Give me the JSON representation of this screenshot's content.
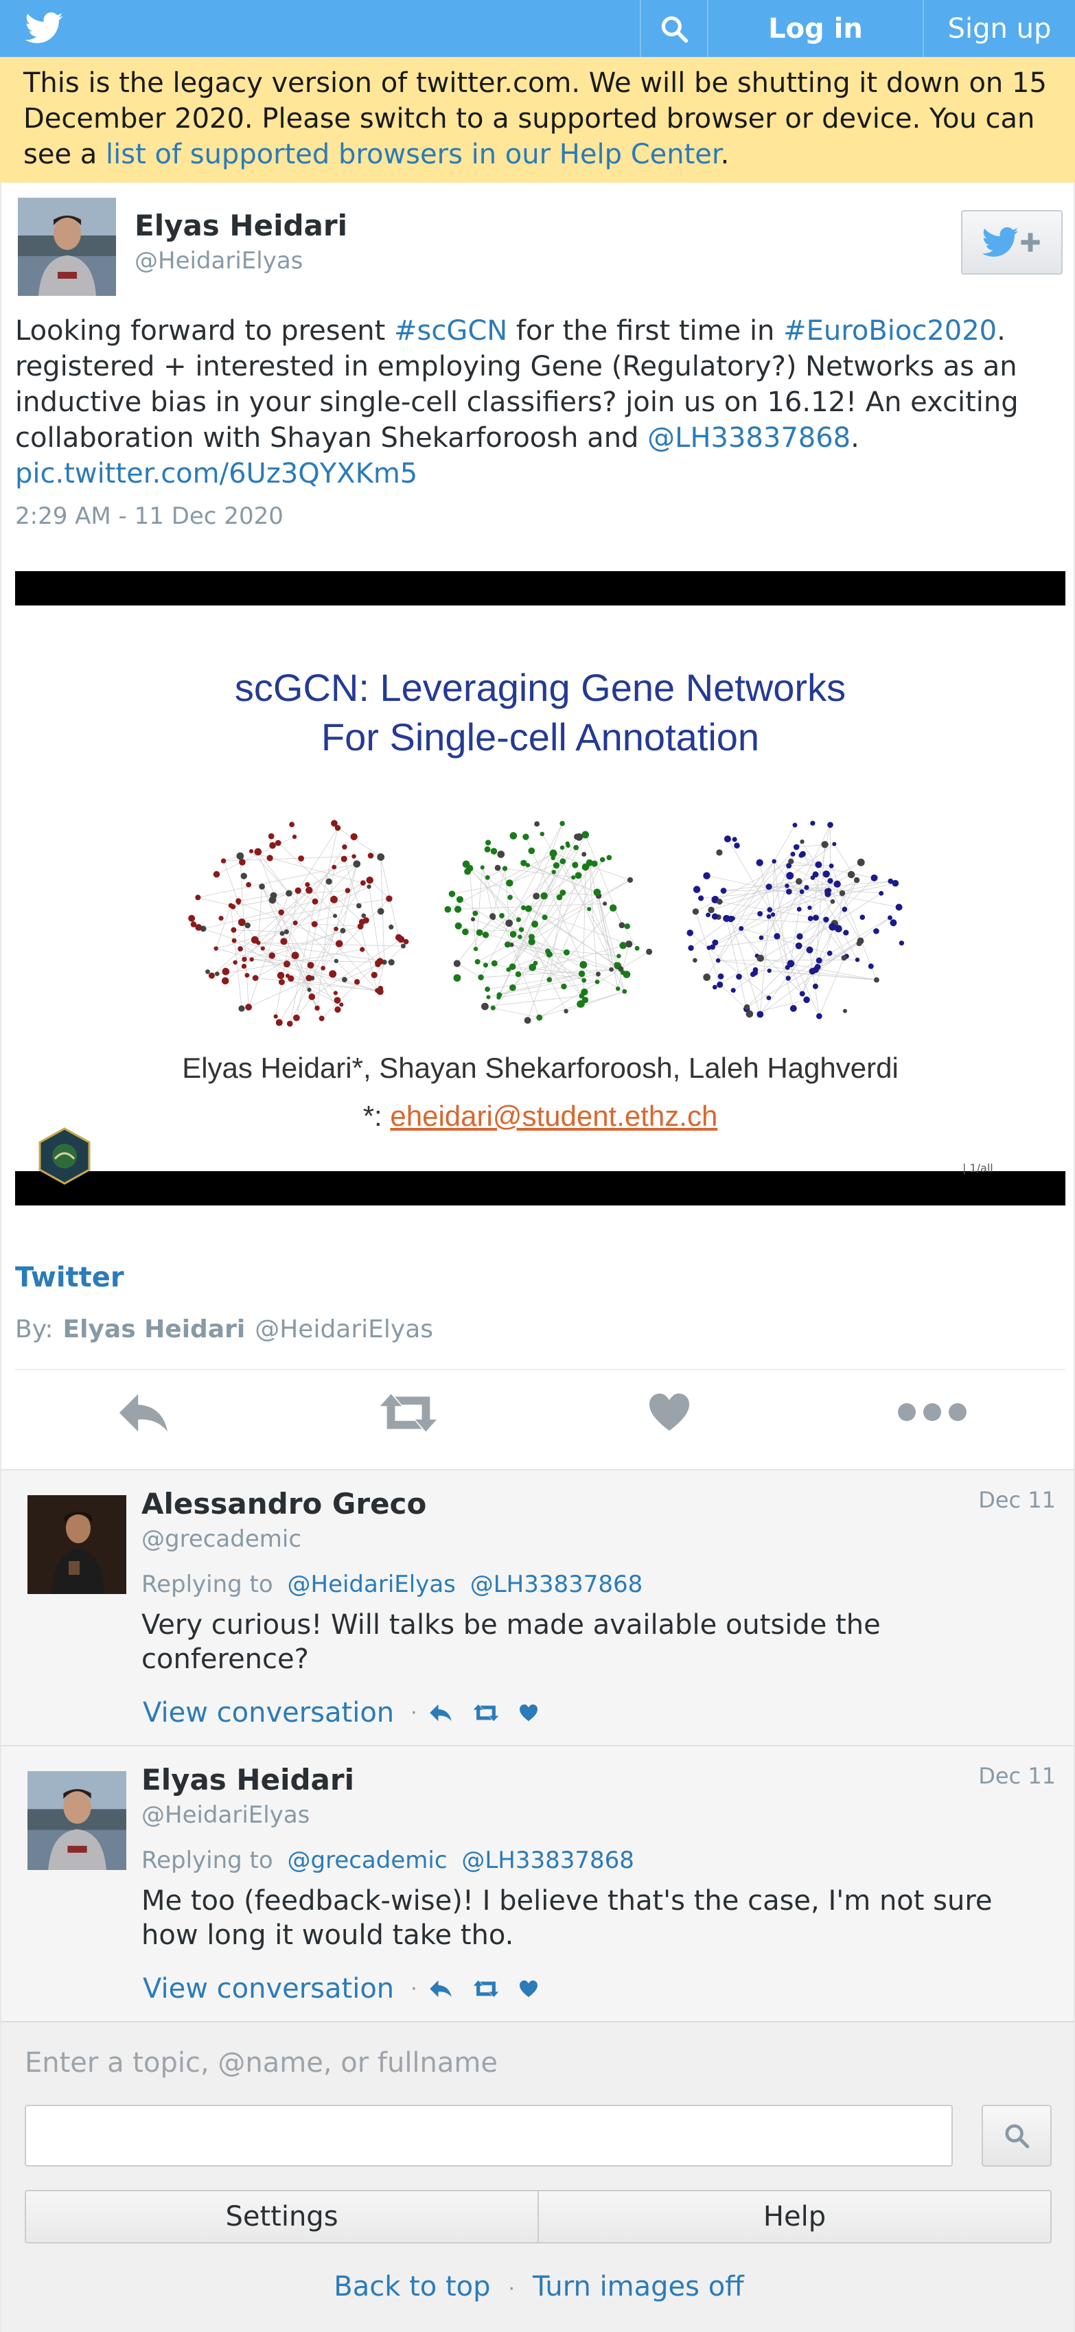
{
  "topbar": {
    "logo_icon": "twitter-bird-icon",
    "search_icon": "search-icon",
    "login_label": "Log in",
    "signup_label": "Sign up",
    "color": "#55acee"
  },
  "banner": {
    "text": "This is the legacy version of twitter.com. We will be shutting it down on 15 December 2020. Please switch to a supported browser or device. You can see a ",
    "link_text": "list of supported browsers in our Help Center",
    "end": "."
  },
  "tweet": {
    "fullname": "Elyas Heidari",
    "username": "@HeidariElyas",
    "text_parts": {
      "t1": "Looking forward to present ",
      "tag1": "#scGCN",
      "t2": " for the first time in ",
      "tag2": "#EuroBioc2020",
      "t3": ". registered + interested in employing Gene (Regulatory?) Networks as an inductive bias in your single-cell classifiers? join us on 16.12! An exciting collaboration with Shayan Shekarforoosh and ",
      "mention": "@LH33837868",
      "t4": ". ",
      "pic": "pic.twitter.com/6Uz3QYXKm5"
    },
    "timestamp": "2:29 AM - 11 Dec 2020",
    "media": {
      "title_line1": "scGCN: Leveraging Gene Networks",
      "title_line2": "For Single-cell Annotation",
      "authors": "Elyas Heidari*, Shayan Shekarforoosh, Laleh Haghverdi",
      "email_prefix": "*: ",
      "email": "eheidari@student.ethz.ch",
      "page": "| 1/all",
      "network_colors": [
        "#8b1a1a",
        "#1a7a1a",
        "#1a1a8b"
      ]
    },
    "card": {
      "title": "Twitter",
      "by_label": "By:",
      "by_name": "Elyas Heidari",
      "by_handle": "@HeidariElyas"
    },
    "actions": [
      "reply-icon",
      "retweet-icon",
      "like-icon",
      "more-icon"
    ]
  },
  "replies": [
    {
      "fullname": "Alessandro Greco",
      "username": "@grecademic",
      "date": "Dec 11",
      "replying_label": "Replying to",
      "replying_to": [
        "@HeidariElyas",
        "@LH33837868"
      ],
      "text": "Very curious! Will talks be made available outside the conference?",
      "view_conversation": "View conversation",
      "separator": "·"
    },
    {
      "fullname": "Elyas Heidari",
      "username": "@HeidariElyas",
      "date": "Dec 11",
      "replying_label": "Replying to",
      "replying_to": [
        "@grecademic",
        "@LH33837868"
      ],
      "text": "Me too (feedback-wise)! I believe that's the case, I'm not sure how long it would take tho.",
      "view_conversation": "View conversation",
      "separator": "·"
    }
  ],
  "footer": {
    "search_label": "Enter a topic, @name, or fullname",
    "search_placeholder": "",
    "settings_label": "Settings",
    "help_label": "Help",
    "back_to_top": "Back to top",
    "separator": "·",
    "turn_images_off": "Turn images off"
  }
}
